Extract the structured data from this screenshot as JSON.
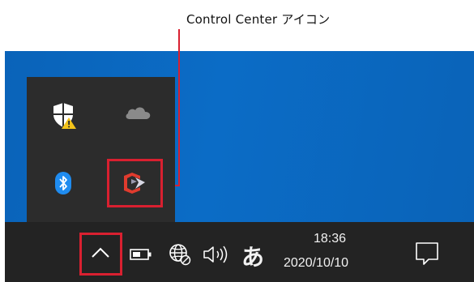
{
  "callout": {
    "text": "Control Center アイコン"
  },
  "clock": {
    "time": "18:36",
    "date": "2020/10/10"
  },
  "ime": {
    "label": "あ"
  },
  "colors": {
    "highlight": "#d92030",
    "taskbar": "#232323",
    "overflow_panel": "#2c2c2c",
    "desktop": "#0a63b9"
  },
  "icons": {
    "overflow": [
      "windows-security-warning-icon",
      "onedrive-icon",
      "bluetooth-icon",
      "control-center-icon"
    ],
    "tray": [
      "show-hidden-icons-chevron-icon",
      "battery-icon",
      "network-globe-icon",
      "speaker-volume-icon",
      "action-center-notification-icon"
    ]
  }
}
